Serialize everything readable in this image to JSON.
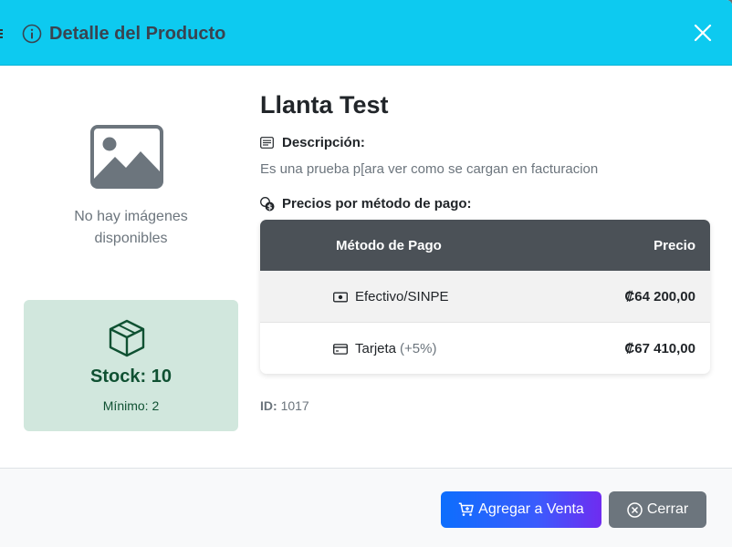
{
  "header": {
    "title": "Detalle del Producto",
    "info_icon": "info-circle-icon",
    "close_icon": "close-icon"
  },
  "left": {
    "image_icon": "image-placeholder-icon",
    "no_images_line1": "No hay imágenes",
    "no_images_line2": "disponibles",
    "stock": {
      "icon": "box-icon",
      "label": "Stock: 10",
      "minimum": "Mínimo: 2"
    }
  },
  "product": {
    "name": "Llanta Test",
    "description_label": "Descripción:",
    "description": "Es una prueba p[ara ver como se cargan en facturacion",
    "prices_label": "Precios por método de pago:",
    "id_label": "ID:",
    "id_value": "1017"
  },
  "price_table": {
    "headers": [
      "Método de Pago",
      "Precio"
    ],
    "rows": [
      {
        "icon": "cash-icon",
        "method": "Efectivo/SINPE",
        "extra": "",
        "price": "₡64 200,00"
      },
      {
        "icon": "credit-card-icon",
        "method": "Tarjeta",
        "extra": "(+5%)",
        "price": "₡67 410,00"
      }
    ]
  },
  "footer": {
    "add_label": "Agregar a Venta",
    "close_label": "Cerrar"
  },
  "colors": {
    "header_bg": "#0dcaf0",
    "stock_bg": "#d1e7dd",
    "stock_text": "#0f5132",
    "table_head": "#4b5157",
    "close_btn": "#6c757d",
    "add_btn_start": "#0d6efd",
    "add_btn_end": "#6f2cf0"
  }
}
